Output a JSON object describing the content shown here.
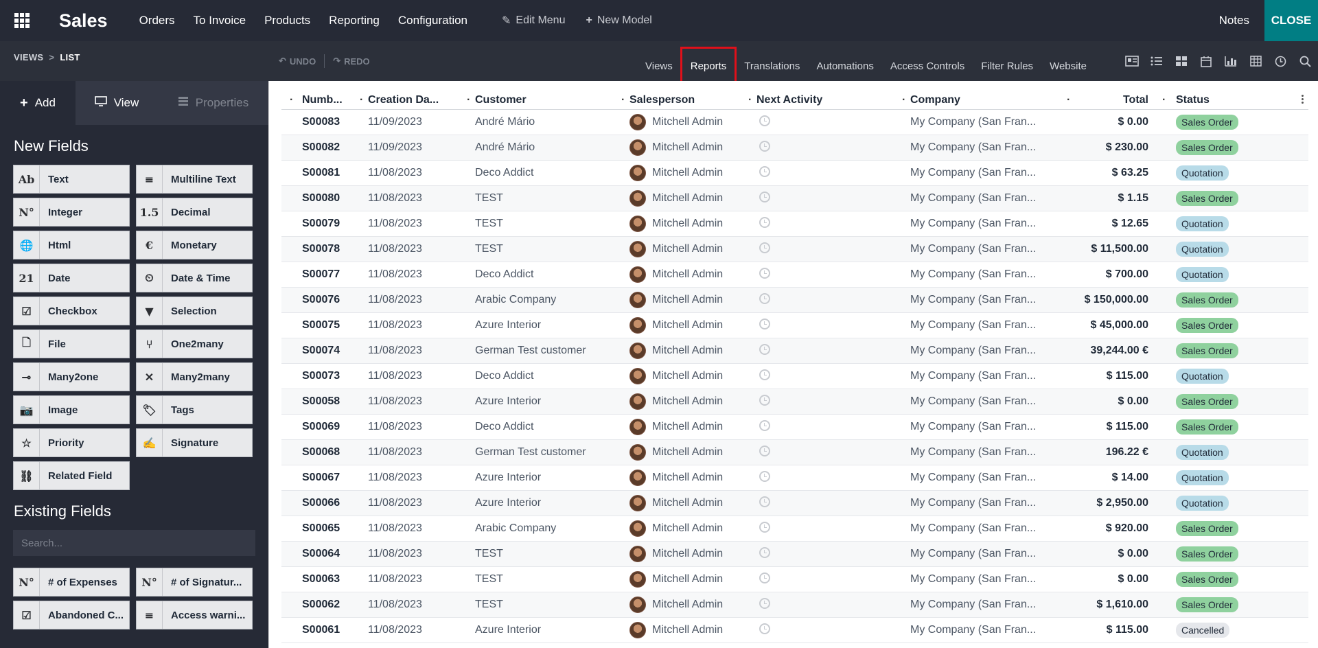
{
  "app": {
    "title": "Sales"
  },
  "nav": {
    "menus": [
      "Orders",
      "To Invoice",
      "Products",
      "Reporting",
      "Configuration"
    ],
    "edit_menu": "Edit Menu",
    "new_model": "New Model",
    "notes": "Notes",
    "close": "CLOSE"
  },
  "studio": {
    "breadcrumb": {
      "root": "VIEWS",
      "current": "LIST"
    },
    "undo": "UNDO",
    "redo": "REDO",
    "tabs": [
      "Views",
      "Reports",
      "Translations",
      "Automations",
      "Access Controls",
      "Filter Rules",
      "Website"
    ],
    "highlighted_tab": "Reports",
    "view_icons": [
      "form-view-icon",
      "list-view-icon",
      "kanban-view-icon",
      "calendar-view-icon",
      "graph-view-icon",
      "pivot-view-icon",
      "activity-view-icon",
      "search-view-icon"
    ]
  },
  "sidebar": {
    "tabs": [
      {
        "label": "Add",
        "icon": "plus-icon"
      },
      {
        "label": "View",
        "icon": "monitor-icon"
      },
      {
        "label": "Properties",
        "icon": "properties-icon"
      }
    ],
    "new_fields_title": "New Fields",
    "new_fields": [
      {
        "label": "Text",
        "icon": "Ab"
      },
      {
        "label": "Multiline Text",
        "icon": "≡"
      },
      {
        "label": "Integer",
        "icon": "N°"
      },
      {
        "label": "Decimal",
        "icon": "1.5"
      },
      {
        "label": "Html",
        "icon": "🌐"
      },
      {
        "label": "Monetary",
        "icon": "€"
      },
      {
        "label": "Date",
        "icon": "21"
      },
      {
        "label": "Date & Time",
        "icon": "⏲"
      },
      {
        "label": "Checkbox",
        "icon": "☑"
      },
      {
        "label": "Selection",
        "icon": "▼"
      },
      {
        "label": "File",
        "icon": "🗋"
      },
      {
        "label": "One2many",
        "icon": "⑂"
      },
      {
        "label": "Many2one",
        "icon": "⊸"
      },
      {
        "label": "Many2many",
        "icon": "✕"
      },
      {
        "label": "Image",
        "icon": "📷"
      },
      {
        "label": "Tags",
        "icon": "🏷"
      },
      {
        "label": "Priority",
        "icon": "☆"
      },
      {
        "label": "Signature",
        "icon": "✍"
      },
      {
        "label": "Related Field",
        "icon": "⛓"
      }
    ],
    "existing_fields_title": "Existing Fields",
    "search_placeholder": "Search...",
    "existing_fields": [
      {
        "label": "# of Expenses",
        "icon": "N°"
      },
      {
        "label": "# of Signatur...",
        "icon": "N°"
      },
      {
        "label": "Abandoned C...",
        "icon": "☑"
      },
      {
        "label": "Access warni...",
        "icon": "≡"
      }
    ]
  },
  "list": {
    "columns": [
      "Numb...",
      "Creation Da...",
      "Customer",
      "Salesperson",
      "Next Activity",
      "Company",
      "Total",
      "Status"
    ],
    "status_colors": {
      "Sales Order": "#8fd19e",
      "Quotation": "#b8dbe8",
      "Cancelled": "#e5e7eb"
    },
    "rows": [
      {
        "number": "S00083",
        "date": "11/09/2023",
        "customer": "André Mário",
        "salesperson": "Mitchell Admin",
        "company": "My Company (San Fran...",
        "total": "$ 0.00",
        "status": "Sales Order"
      },
      {
        "number": "S00082",
        "date": "11/09/2023",
        "customer": "André Mário",
        "salesperson": "Mitchell Admin",
        "company": "My Company (San Fran...",
        "total": "$ 230.00",
        "status": "Sales Order"
      },
      {
        "number": "S00081",
        "date": "11/08/2023",
        "customer": "Deco Addict",
        "salesperson": "Mitchell Admin",
        "company": "My Company (San Fran...",
        "total": "$ 63.25",
        "status": "Quotation"
      },
      {
        "number": "S00080",
        "date": "11/08/2023",
        "customer": "TEST",
        "salesperson": "Mitchell Admin",
        "company": "My Company (San Fran...",
        "total": "$ 1.15",
        "status": "Sales Order"
      },
      {
        "number": "S00079",
        "date": "11/08/2023",
        "customer": "TEST",
        "salesperson": "Mitchell Admin",
        "company": "My Company (San Fran...",
        "total": "$ 12.65",
        "status": "Quotation"
      },
      {
        "number": "S00078",
        "date": "11/08/2023",
        "customer": "TEST",
        "salesperson": "Mitchell Admin",
        "company": "My Company (San Fran...",
        "total": "$ 11,500.00",
        "status": "Quotation"
      },
      {
        "number": "S00077",
        "date": "11/08/2023",
        "customer": "Deco Addict",
        "salesperson": "Mitchell Admin",
        "company": "My Company (San Fran...",
        "total": "$ 700.00",
        "status": "Quotation"
      },
      {
        "number": "S00076",
        "date": "11/08/2023",
        "customer": "Arabic Company",
        "salesperson": "Mitchell Admin",
        "company": "My Company (San Fran...",
        "total": "$ 150,000.00",
        "status": "Sales Order"
      },
      {
        "number": "S00075",
        "date": "11/08/2023",
        "customer": "Azure Interior",
        "salesperson": "Mitchell Admin",
        "company": "My Company (San Fran...",
        "total": "$ 45,000.00",
        "status": "Sales Order"
      },
      {
        "number": "S00074",
        "date": "11/08/2023",
        "customer": "German Test customer",
        "salesperson": "Mitchell Admin",
        "company": "My Company (San Fran...",
        "total": "39,244.00 €",
        "status": "Sales Order"
      },
      {
        "number": "S00073",
        "date": "11/08/2023",
        "customer": "Deco Addict",
        "salesperson": "Mitchell Admin",
        "company": "My Company (San Fran...",
        "total": "$ 115.00",
        "status": "Quotation"
      },
      {
        "number": "S00058",
        "date": "11/08/2023",
        "customer": "Azure Interior",
        "salesperson": "Mitchell Admin",
        "company": "My Company (San Fran...",
        "total": "$ 0.00",
        "status": "Sales Order"
      },
      {
        "number": "S00069",
        "date": "11/08/2023",
        "customer": "Deco Addict",
        "salesperson": "Mitchell Admin",
        "company": "My Company (San Fran...",
        "total": "$ 115.00",
        "status": "Sales Order"
      },
      {
        "number": "S00068",
        "date": "11/08/2023",
        "customer": "German Test customer",
        "salesperson": "Mitchell Admin",
        "company": "My Company (San Fran...",
        "total": "196.22 €",
        "status": "Quotation"
      },
      {
        "number": "S00067",
        "date": "11/08/2023",
        "customer": "Azure Interior",
        "salesperson": "Mitchell Admin",
        "company": "My Company (San Fran...",
        "total": "$ 14.00",
        "status": "Quotation"
      },
      {
        "number": "S00066",
        "date": "11/08/2023",
        "customer": "Azure Interior",
        "salesperson": "Mitchell Admin",
        "company": "My Company (San Fran...",
        "total": "$ 2,950.00",
        "status": "Quotation"
      },
      {
        "number": "S00065",
        "date": "11/08/2023",
        "customer": "Arabic Company",
        "salesperson": "Mitchell Admin",
        "company": "My Company (San Fran...",
        "total": "$ 920.00",
        "status": "Sales Order"
      },
      {
        "number": "S00064",
        "date": "11/08/2023",
        "customer": "TEST",
        "salesperson": "Mitchell Admin",
        "company": "My Company (San Fran...",
        "total": "$ 0.00",
        "status": "Sales Order"
      },
      {
        "number": "S00063",
        "date": "11/08/2023",
        "customer": "TEST",
        "salesperson": "Mitchell Admin",
        "company": "My Company (San Fran...",
        "total": "$ 0.00",
        "status": "Sales Order"
      },
      {
        "number": "S00062",
        "date": "11/08/2023",
        "customer": "TEST",
        "salesperson": "Mitchell Admin",
        "company": "My Company (San Fran...",
        "total": "$ 1,610.00",
        "status": "Sales Order"
      },
      {
        "number": "S00061",
        "date": "11/08/2023",
        "customer": "Azure Interior",
        "salesperson": "Mitchell Admin",
        "company": "My Company (San Fran...",
        "total": "$ 115.00",
        "status": "Cancelled"
      }
    ]
  }
}
